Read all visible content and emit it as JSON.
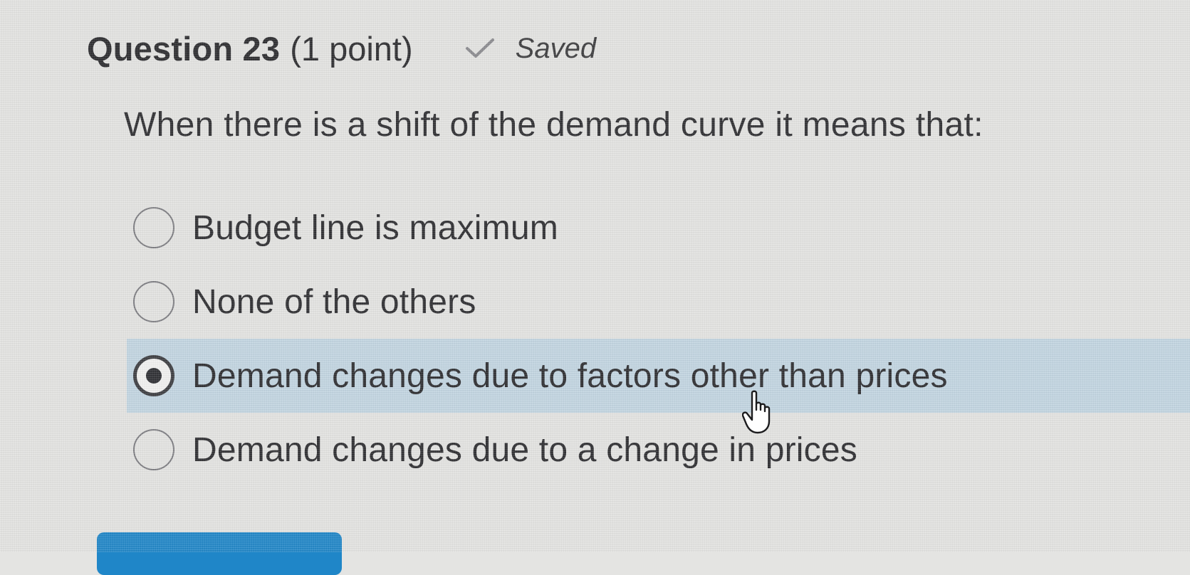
{
  "question": {
    "title": "Question 23",
    "points": "(1 point)",
    "status_icon": "check-icon",
    "status_label": "Saved",
    "prompt": "When there is a shift of the demand curve it means that:"
  },
  "options": [
    {
      "label": "Budget line is maximum",
      "selected": false
    },
    {
      "label": "None of the others",
      "selected": false
    },
    {
      "label": "Demand changes due to factors other than prices",
      "selected": true
    },
    {
      "label": "Demand changes due to a change in prices",
      "selected": false
    }
  ],
  "cursor": "hand-pointer-icon",
  "colors": {
    "background": "#e4e4e2",
    "selected_row": "#c3d6e2",
    "button": "#1f86c8",
    "text": "#2a2a2c"
  }
}
